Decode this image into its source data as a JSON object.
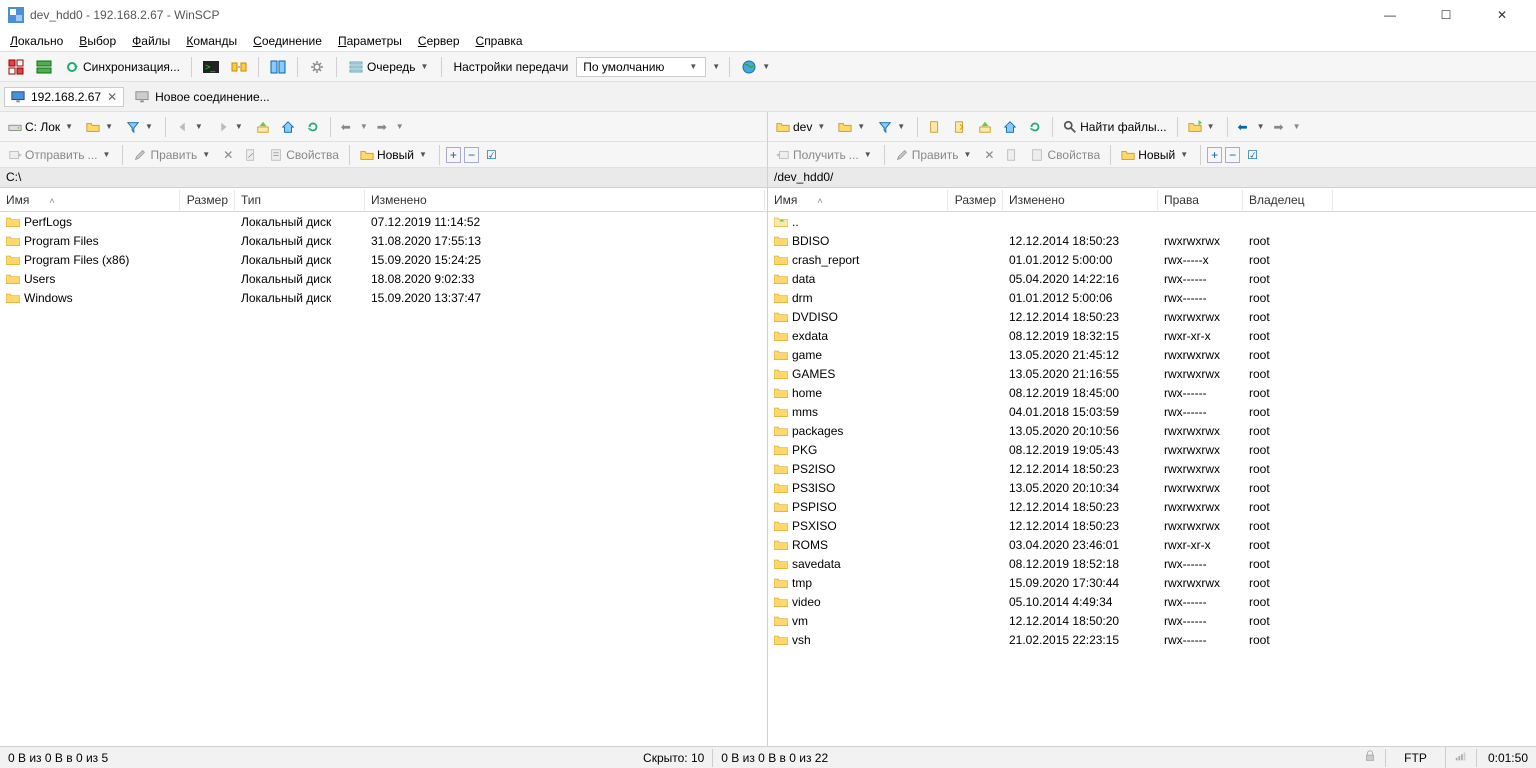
{
  "window": {
    "title": "dev_hdd0 - 192.168.2.67 - WinSCP"
  },
  "menu": [
    "Локально",
    "Выбор",
    "Файлы",
    "Команды",
    "Соединение",
    "Параметры",
    "Сервер",
    "Справка"
  ],
  "toolbar1": {
    "sync": "Синхронизация...",
    "queue": "Очередь",
    "transfer_label": "Настройки передачи",
    "transfer_value": "По умолчанию"
  },
  "tabs": {
    "active": "192.168.2.67",
    "new_session": "Новое соединение..."
  },
  "left": {
    "disk_label": "C: Лок",
    "send": "Отправить",
    "edit": "Править",
    "props": "Свойства",
    "new": "Новый",
    "path": "C:\\",
    "columns": [
      "Имя",
      "Размер",
      "Тип",
      "Изменено"
    ],
    "widths": [
      180,
      55,
      130,
      400
    ],
    "rows": [
      {
        "name": "PerfLogs",
        "size": "",
        "type": "Локальный диск",
        "changed": "07.12.2019  11:14:52"
      },
      {
        "name": "Program Files",
        "size": "",
        "type": "Локальный диск",
        "changed": "31.08.2020  17:55:13"
      },
      {
        "name": "Program Files (x86)",
        "size": "",
        "type": "Локальный диск",
        "changed": "15.09.2020  15:24:25"
      },
      {
        "name": "Users",
        "size": "",
        "type": "Локальный диск",
        "changed": "18.08.2020  9:02:33"
      },
      {
        "name": "Windows",
        "size": "",
        "type": "Локальный диск",
        "changed": "15.09.2020  13:37:47"
      }
    ],
    "status": "0 B из 0 B в 0 из 5",
    "hidden": "Скрыто: 10"
  },
  "right": {
    "disk_label": "dev",
    "find": "Найти файлы...",
    "get": "Получить",
    "edit": "Править",
    "props": "Свойства",
    "new": "Новый",
    "path": "/dev_hdd0/",
    "columns": [
      "Имя",
      "Размер",
      "Изменено",
      "Права",
      "Владелец"
    ],
    "widths": [
      180,
      55,
      155,
      85,
      90
    ],
    "rows": [
      {
        "name": "..",
        "size": "",
        "changed": "",
        "rights": "",
        "owner": "",
        "parent": true
      },
      {
        "name": "BDISO",
        "size": "",
        "changed": "12.12.2014 18:50:23",
        "rights": "rwxrwxrwx",
        "owner": "root"
      },
      {
        "name": "crash_report",
        "size": "",
        "changed": "01.01.2012 5:00:00",
        "rights": "rwx-----x",
        "owner": "root"
      },
      {
        "name": "data",
        "size": "",
        "changed": "05.04.2020 14:22:16",
        "rights": "rwx------",
        "owner": "root"
      },
      {
        "name": "drm",
        "size": "",
        "changed": "01.01.2012 5:00:06",
        "rights": "rwx------",
        "owner": "root"
      },
      {
        "name": "DVDISO",
        "size": "",
        "changed": "12.12.2014 18:50:23",
        "rights": "rwxrwxrwx",
        "owner": "root"
      },
      {
        "name": "exdata",
        "size": "",
        "changed": "08.12.2019 18:32:15",
        "rights": "rwxr-xr-x",
        "owner": "root"
      },
      {
        "name": "game",
        "size": "",
        "changed": "13.05.2020 21:45:12",
        "rights": "rwxrwxrwx",
        "owner": "root"
      },
      {
        "name": "GAMES",
        "size": "",
        "changed": "13.05.2020 21:16:55",
        "rights": "rwxrwxrwx",
        "owner": "root"
      },
      {
        "name": "home",
        "size": "",
        "changed": "08.12.2019 18:45:00",
        "rights": "rwx------",
        "owner": "root"
      },
      {
        "name": "mms",
        "size": "",
        "changed": "04.01.2018 15:03:59",
        "rights": "rwx------",
        "owner": "root"
      },
      {
        "name": "packages",
        "size": "",
        "changed": "13.05.2020 20:10:56",
        "rights": "rwxrwxrwx",
        "owner": "root"
      },
      {
        "name": "PKG",
        "size": "",
        "changed": "08.12.2019 19:05:43",
        "rights": "rwxrwxrwx",
        "owner": "root"
      },
      {
        "name": "PS2ISO",
        "size": "",
        "changed": "12.12.2014 18:50:23",
        "rights": "rwxrwxrwx",
        "owner": "root"
      },
      {
        "name": "PS3ISO",
        "size": "",
        "changed": "13.05.2020 20:10:34",
        "rights": "rwxrwxrwx",
        "owner": "root"
      },
      {
        "name": "PSPISO",
        "size": "",
        "changed": "12.12.2014 18:50:23",
        "rights": "rwxrwxrwx",
        "owner": "root"
      },
      {
        "name": "PSXISO",
        "size": "",
        "changed": "12.12.2014 18:50:23",
        "rights": "rwxrwxrwx",
        "owner": "root"
      },
      {
        "name": "ROMS",
        "size": "",
        "changed": "03.04.2020 23:46:01",
        "rights": "rwxr-xr-x",
        "owner": "root"
      },
      {
        "name": "savedata",
        "size": "",
        "changed": "08.12.2019 18:52:18",
        "rights": "rwx------",
        "owner": "root"
      },
      {
        "name": "tmp",
        "size": "",
        "changed": "15.09.2020 17:30:44",
        "rights": "rwxrwxrwx",
        "owner": "root"
      },
      {
        "name": "video",
        "size": "",
        "changed": "05.10.2014 4:49:34",
        "rights": "rwx------",
        "owner": "root"
      },
      {
        "name": "vm",
        "size": "",
        "changed": "12.12.2014 18:50:20",
        "rights": "rwx------",
        "owner": "root"
      },
      {
        "name": "vsh",
        "size": "",
        "changed": "21.02.2015 22:23:15",
        "rights": "rwx------",
        "owner": "root"
      }
    ],
    "status": "0 B из 0 B в 0 из 22"
  },
  "footer": {
    "proto": "FTP",
    "time": "0:01:50"
  }
}
